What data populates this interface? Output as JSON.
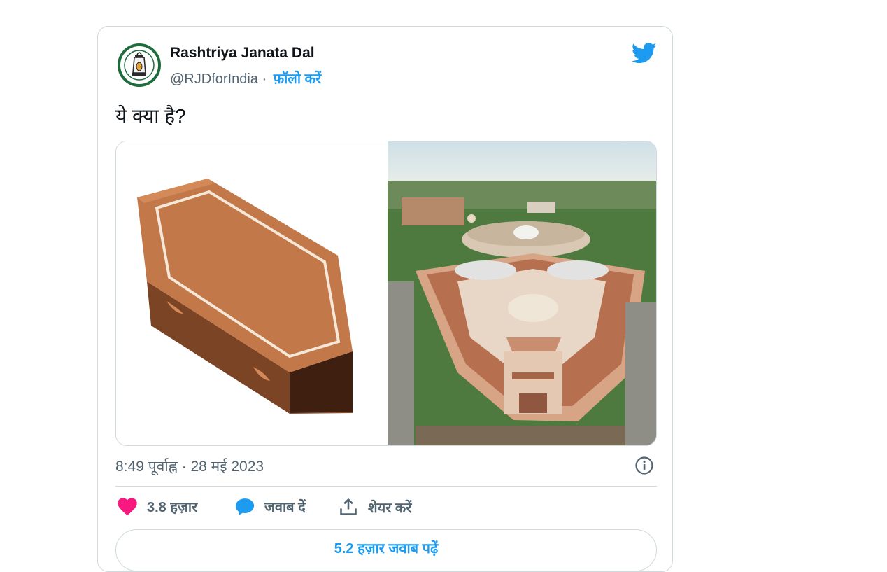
{
  "tweet": {
    "author_name": "Rashtriya Janata Dal",
    "handle": "@RJDforIndia",
    "separator": "·",
    "follow_label": "फ़ॉलो करें",
    "text": "ये क्या है?",
    "timestamp": "8:49 पूर्वाह्न · 28 मई 2023"
  },
  "actions": {
    "likes": "3.8 हज़ार",
    "reply": "जवाब दें",
    "share": "शेयर करें"
  },
  "replies_button": "5.2 हज़ार जवाब पढ़ें",
  "icons": {
    "brand": "twitter-bird-icon",
    "info": "info-icon",
    "like": "heart-icon",
    "reply": "speech-bubble-icon",
    "share": "share-icon"
  },
  "colors": {
    "accent": "#1d9bf0",
    "like": "#f91880",
    "muted": "#536471",
    "avatar_ring": "#1e6b3c"
  }
}
